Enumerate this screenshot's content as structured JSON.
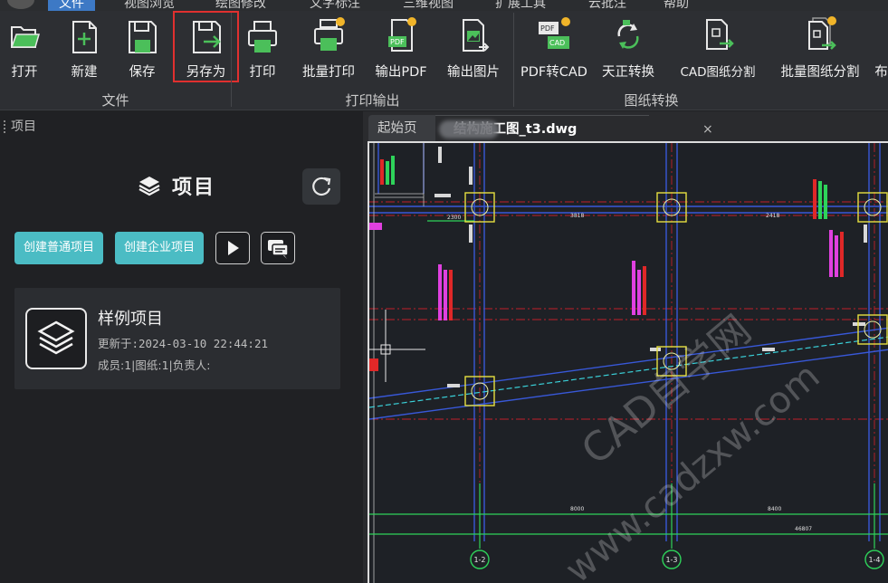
{
  "menu": {
    "items": [
      "文件",
      "视图浏览",
      "绘图修改",
      "文字标注",
      "三维视图",
      "扩展工具",
      "云批注",
      "帮助"
    ]
  },
  "ribbon": {
    "groups": [
      {
        "label": "文件"
      },
      {
        "label": "打印输出"
      },
      {
        "label": "图纸转换"
      }
    ],
    "buttons": {
      "open": "打开",
      "new": "新建",
      "save": "保存",
      "save_as": "另存为",
      "print": "打印",
      "batch_print": "批量打印",
      "export_pdf": "输出PDF",
      "export_image": "输出图片",
      "pdf_to_cad": "PDF转CAD",
      "tianzheng_convert": "天正转换",
      "cad_split": "CAD图纸分割",
      "batch_split": "批量图纸分割",
      "more": "布"
    },
    "icon_text": {
      "pdf": "PDF",
      "cad": "CAD"
    }
  },
  "panel": {
    "header": "项目",
    "title": "项目",
    "create_normal": "创建普通项目",
    "create_enterprise": "创建企业项目",
    "project": {
      "name": "样例项目",
      "updated": "更新于:2024-03-10 22:44:21",
      "meta": "成员:1|图纸:1|负责人:"
    }
  },
  "tabs": {
    "home": "起始页",
    "file": "结构施工图_t3.dwg",
    "close": "×"
  },
  "drawing": {
    "grid_labels": [
      "1-2",
      "1-3",
      "1-4"
    ],
    "dims": [
      "8000",
      "8400",
      "46807",
      "2300",
      "3818",
      "2418"
    ],
    "watermark_cn": "CAD自学网",
    "watermark_url": "www.cadzxw.com"
  },
  "colors": {
    "accent_teal": "#4bbcc4",
    "highlight_red": "#e0302f",
    "ribbon_bg": "#2d2f33",
    "panel_bg": "#202124"
  }
}
